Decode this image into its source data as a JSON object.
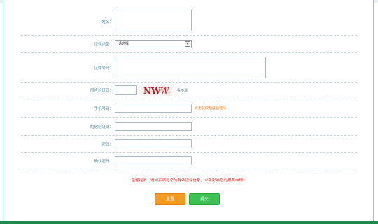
{
  "form": {
    "name_label": "姓名：",
    "id_type_label": "证件类型：",
    "id_type_selected": "请选择",
    "id_number_label": "证件号码：",
    "image_captcha_label": "图片验证码：",
    "captcha_text": "NW",
    "captcha_refresh": "看不清",
    "phone_label": "手机号码：",
    "sms_link": "点击获取短信验证码",
    "sms_code_label": "短信验证码：",
    "password_label": "密码：",
    "confirm_password_label": "确认密码："
  },
  "notice": "温馨提示：请如实填写您的有效证件信息，以免影响您的报名申请！",
  "buttons": {
    "reset_label": "重置",
    "submit_label": "提交"
  },
  "colors": {
    "label": "#4a8aa6",
    "notice": "#e0201c",
    "sms_link": "#f07a1a",
    "reset_button": "#f39a22",
    "submit_button": "#3cc152",
    "bottom_bar": "#1f8a4c"
  }
}
